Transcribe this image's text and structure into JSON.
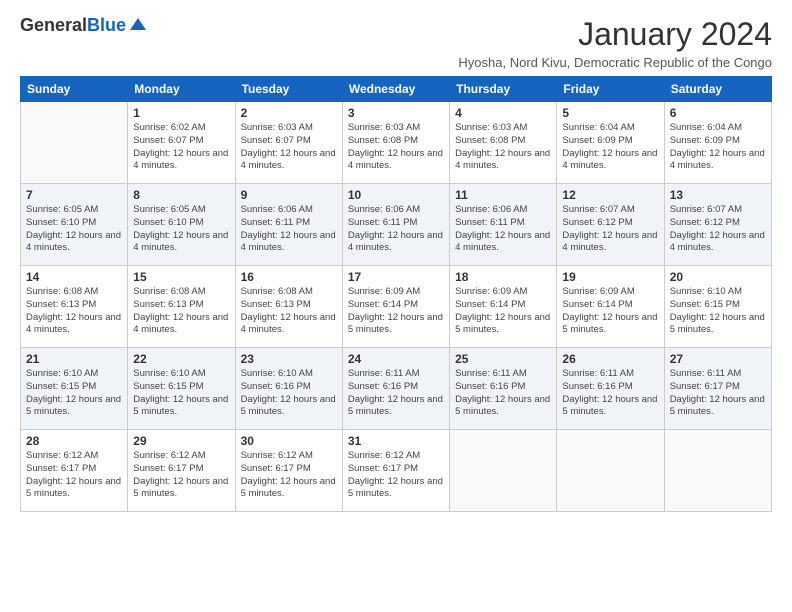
{
  "logo": {
    "text_general": "General",
    "text_blue": "Blue"
  },
  "title": "January 2024",
  "subtitle": "Hyosha, Nord Kivu, Democratic Republic of the Congo",
  "weekdays": [
    "Sunday",
    "Monday",
    "Tuesday",
    "Wednesday",
    "Thursday",
    "Friday",
    "Saturday"
  ],
  "weeks": [
    [
      {
        "day": "",
        "sunrise": "",
        "sunset": "",
        "daylight": ""
      },
      {
        "day": "1",
        "sunrise": "Sunrise: 6:02 AM",
        "sunset": "Sunset: 6:07 PM",
        "daylight": "Daylight: 12 hours and 4 minutes."
      },
      {
        "day": "2",
        "sunrise": "Sunrise: 6:03 AM",
        "sunset": "Sunset: 6:07 PM",
        "daylight": "Daylight: 12 hours and 4 minutes."
      },
      {
        "day": "3",
        "sunrise": "Sunrise: 6:03 AM",
        "sunset": "Sunset: 6:08 PM",
        "daylight": "Daylight: 12 hours and 4 minutes."
      },
      {
        "day": "4",
        "sunrise": "Sunrise: 6:03 AM",
        "sunset": "Sunset: 6:08 PM",
        "daylight": "Daylight: 12 hours and 4 minutes."
      },
      {
        "day": "5",
        "sunrise": "Sunrise: 6:04 AM",
        "sunset": "Sunset: 6:09 PM",
        "daylight": "Daylight: 12 hours and 4 minutes."
      },
      {
        "day": "6",
        "sunrise": "Sunrise: 6:04 AM",
        "sunset": "Sunset: 6:09 PM",
        "daylight": "Daylight: 12 hours and 4 minutes."
      }
    ],
    [
      {
        "day": "7",
        "sunrise": "Sunrise: 6:05 AM",
        "sunset": "Sunset: 6:10 PM",
        "daylight": "Daylight: 12 hours and 4 minutes."
      },
      {
        "day": "8",
        "sunrise": "Sunrise: 6:05 AM",
        "sunset": "Sunset: 6:10 PM",
        "daylight": "Daylight: 12 hours and 4 minutes."
      },
      {
        "day": "9",
        "sunrise": "Sunrise: 6:06 AM",
        "sunset": "Sunset: 6:11 PM",
        "daylight": "Daylight: 12 hours and 4 minutes."
      },
      {
        "day": "10",
        "sunrise": "Sunrise: 6:06 AM",
        "sunset": "Sunset: 6:11 PM",
        "daylight": "Daylight: 12 hours and 4 minutes."
      },
      {
        "day": "11",
        "sunrise": "Sunrise: 6:06 AM",
        "sunset": "Sunset: 6:11 PM",
        "daylight": "Daylight: 12 hours and 4 minutes."
      },
      {
        "day": "12",
        "sunrise": "Sunrise: 6:07 AM",
        "sunset": "Sunset: 6:12 PM",
        "daylight": "Daylight: 12 hours and 4 minutes."
      },
      {
        "day": "13",
        "sunrise": "Sunrise: 6:07 AM",
        "sunset": "Sunset: 6:12 PM",
        "daylight": "Daylight: 12 hours and 4 minutes."
      }
    ],
    [
      {
        "day": "14",
        "sunrise": "Sunrise: 6:08 AM",
        "sunset": "Sunset: 6:13 PM",
        "daylight": "Daylight: 12 hours and 4 minutes."
      },
      {
        "day": "15",
        "sunrise": "Sunrise: 6:08 AM",
        "sunset": "Sunset: 6:13 PM",
        "daylight": "Daylight: 12 hours and 4 minutes."
      },
      {
        "day": "16",
        "sunrise": "Sunrise: 6:08 AM",
        "sunset": "Sunset: 6:13 PM",
        "daylight": "Daylight: 12 hours and 4 minutes."
      },
      {
        "day": "17",
        "sunrise": "Sunrise: 6:09 AM",
        "sunset": "Sunset: 6:14 PM",
        "daylight": "Daylight: 12 hours and 5 minutes."
      },
      {
        "day": "18",
        "sunrise": "Sunrise: 6:09 AM",
        "sunset": "Sunset: 6:14 PM",
        "daylight": "Daylight: 12 hours and 5 minutes."
      },
      {
        "day": "19",
        "sunrise": "Sunrise: 6:09 AM",
        "sunset": "Sunset: 6:14 PM",
        "daylight": "Daylight: 12 hours and 5 minutes."
      },
      {
        "day": "20",
        "sunrise": "Sunrise: 6:10 AM",
        "sunset": "Sunset: 6:15 PM",
        "daylight": "Daylight: 12 hours and 5 minutes."
      }
    ],
    [
      {
        "day": "21",
        "sunrise": "Sunrise: 6:10 AM",
        "sunset": "Sunset: 6:15 PM",
        "daylight": "Daylight: 12 hours and 5 minutes."
      },
      {
        "day": "22",
        "sunrise": "Sunrise: 6:10 AM",
        "sunset": "Sunset: 6:15 PM",
        "daylight": "Daylight: 12 hours and 5 minutes."
      },
      {
        "day": "23",
        "sunrise": "Sunrise: 6:10 AM",
        "sunset": "Sunset: 6:16 PM",
        "daylight": "Daylight: 12 hours and 5 minutes."
      },
      {
        "day": "24",
        "sunrise": "Sunrise: 6:11 AM",
        "sunset": "Sunset: 6:16 PM",
        "daylight": "Daylight: 12 hours and 5 minutes."
      },
      {
        "day": "25",
        "sunrise": "Sunrise: 6:11 AM",
        "sunset": "Sunset: 6:16 PM",
        "daylight": "Daylight: 12 hours and 5 minutes."
      },
      {
        "day": "26",
        "sunrise": "Sunrise: 6:11 AM",
        "sunset": "Sunset: 6:16 PM",
        "daylight": "Daylight: 12 hours and 5 minutes."
      },
      {
        "day": "27",
        "sunrise": "Sunrise: 6:11 AM",
        "sunset": "Sunset: 6:17 PM",
        "daylight": "Daylight: 12 hours and 5 minutes."
      }
    ],
    [
      {
        "day": "28",
        "sunrise": "Sunrise: 6:12 AM",
        "sunset": "Sunset: 6:17 PM",
        "daylight": "Daylight: 12 hours and 5 minutes."
      },
      {
        "day": "29",
        "sunrise": "Sunrise: 6:12 AM",
        "sunset": "Sunset: 6:17 PM",
        "daylight": "Daylight: 12 hours and 5 minutes."
      },
      {
        "day": "30",
        "sunrise": "Sunrise: 6:12 AM",
        "sunset": "Sunset: 6:17 PM",
        "daylight": "Daylight: 12 hours and 5 minutes."
      },
      {
        "day": "31",
        "sunrise": "Sunrise: 6:12 AM",
        "sunset": "Sunset: 6:17 PM",
        "daylight": "Daylight: 12 hours and 5 minutes."
      },
      {
        "day": "",
        "sunrise": "",
        "sunset": "",
        "daylight": ""
      },
      {
        "day": "",
        "sunrise": "",
        "sunset": "",
        "daylight": ""
      },
      {
        "day": "",
        "sunrise": "",
        "sunset": "",
        "daylight": ""
      }
    ]
  ]
}
